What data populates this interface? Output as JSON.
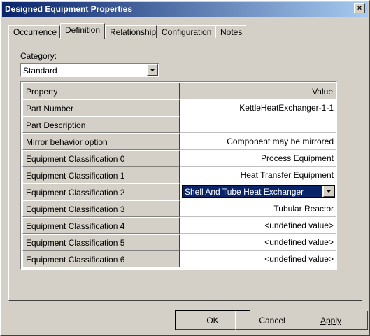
{
  "window": {
    "title": "Designed Equipment Properties",
    "close_label": "×"
  },
  "tabs": [
    {
      "label": "Occurrence"
    },
    {
      "label": "Definition"
    },
    {
      "label": "Relationship"
    },
    {
      "label": "Configuration"
    },
    {
      "label": "Notes"
    }
  ],
  "category": {
    "label": "Category:",
    "value": "Standard"
  },
  "grid": {
    "headers": {
      "property": "Property",
      "value": "Value"
    },
    "rows": [
      {
        "name": "Part Number",
        "value": "KettleHeatExchanger-1-1"
      },
      {
        "name": "Part Description",
        "value": ""
      },
      {
        "name": "Mirror behavior option",
        "value": "Component may be mirrored"
      },
      {
        "name": "Equipment Classification 0",
        "value": "Process Equipment"
      },
      {
        "name": "Equipment Classification 1",
        "value": "Heat Transfer Equipment"
      },
      {
        "name": "Equipment Classification 2",
        "value": "Shell And Tube Heat Exchanger"
      },
      {
        "name": "Equipment Classification 3",
        "value": "Tubular Reactor"
      },
      {
        "name": "Equipment Classification 4",
        "value": "<undefined value>"
      },
      {
        "name": "Equipment Classification 5",
        "value": "<undefined value>"
      },
      {
        "name": "Equipment Classification 6",
        "value": "<undefined value>"
      }
    ]
  },
  "buttons": {
    "ok": "OK",
    "cancel": "Cancel",
    "apply": "Apply"
  }
}
